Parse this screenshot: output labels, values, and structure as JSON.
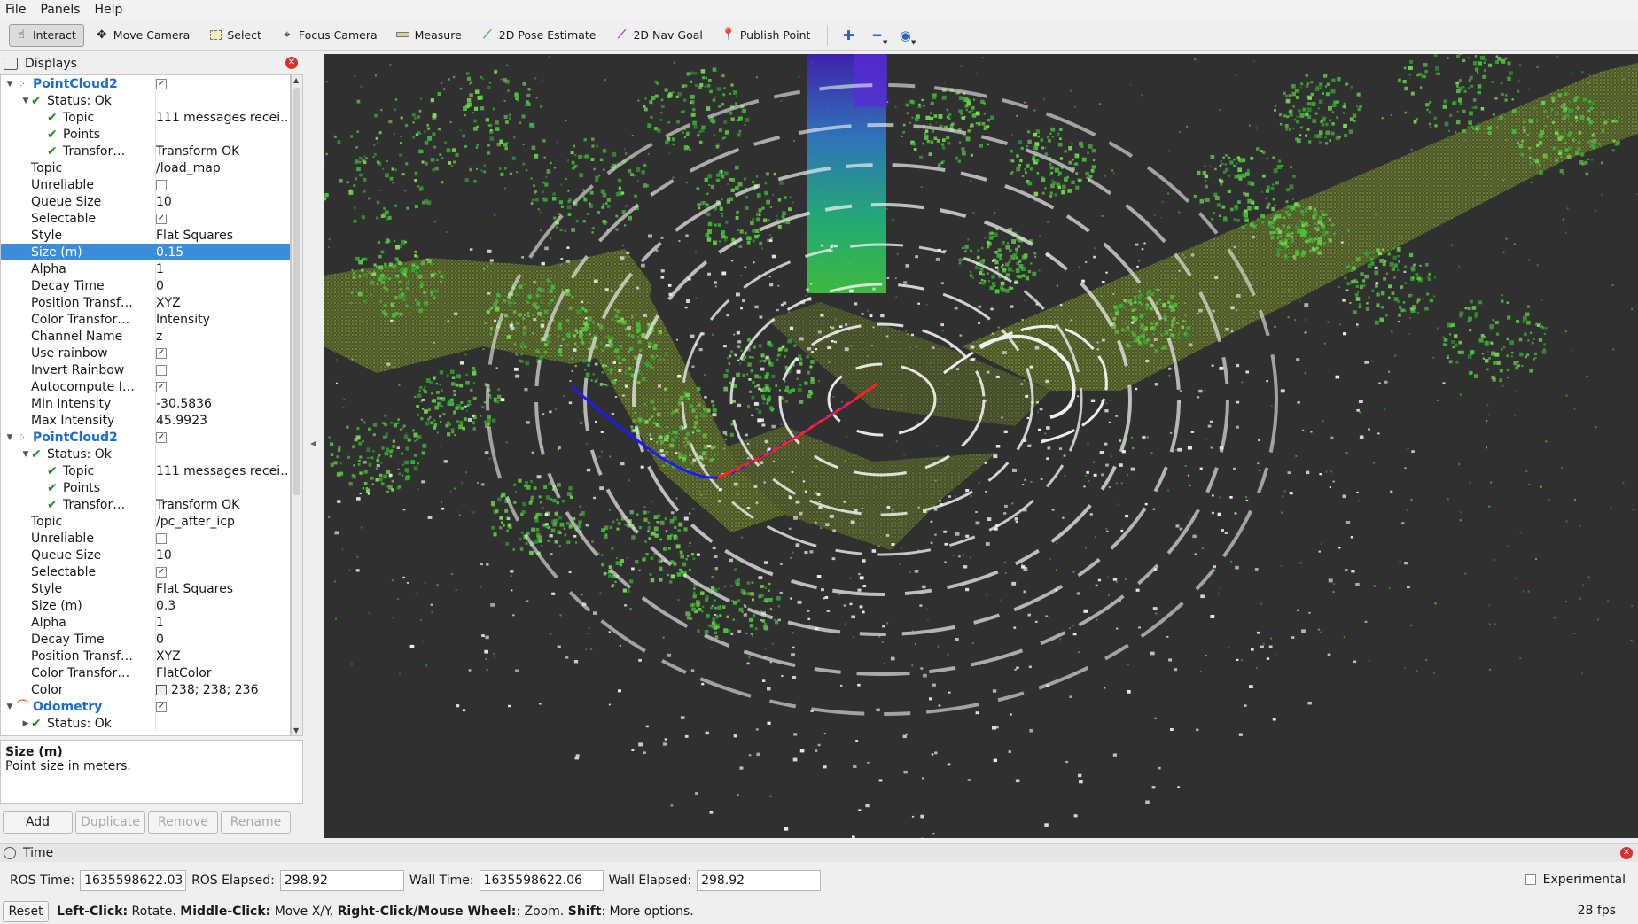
{
  "menu": [
    "File",
    "Panels",
    "Help"
  ],
  "toolbar": {
    "tools": [
      {
        "label": "Interact",
        "icon": "hand-icon",
        "active": true
      },
      {
        "label": "Move Camera",
        "icon": "move-camera-icon",
        "active": false
      },
      {
        "label": "Select",
        "icon": "select-icon",
        "active": false
      },
      {
        "label": "Focus Camera",
        "icon": "focus-camera-icon",
        "active": false
      },
      {
        "label": "Measure",
        "icon": "measure-icon",
        "active": false
      },
      {
        "label": "2D Pose Estimate",
        "icon": "pose-estimate-icon",
        "active": false
      },
      {
        "label": "2D Nav Goal",
        "icon": "nav-goal-icon",
        "active": false
      },
      {
        "label": "Publish Point",
        "icon": "publish-point-icon",
        "active": false
      }
    ]
  },
  "displays": {
    "title": "Displays",
    "tree": [
      {
        "indent": 0,
        "arrow": "down",
        "icon": "pointcloud",
        "label": "PointCloud2",
        "value_checkbox": true,
        "plugin": true
      },
      {
        "indent": 1,
        "arrow": "down",
        "check": true,
        "label": "Status: Ok",
        "value": ""
      },
      {
        "indent": 2,
        "check": true,
        "label": "Topic",
        "value": "111 messages recei…"
      },
      {
        "indent": 2,
        "check": true,
        "label": "Points",
        "value": ""
      },
      {
        "indent": 2,
        "check": true,
        "label": "Transfor…",
        "value": "Transform OK"
      },
      {
        "indent": 1,
        "label": "Topic",
        "value": "/load_map"
      },
      {
        "indent": 1,
        "label": "Unreliable",
        "value_checkbox": false
      },
      {
        "indent": 1,
        "label": "Queue Size",
        "value": "10"
      },
      {
        "indent": 1,
        "label": "Selectable",
        "value_checkbox": true
      },
      {
        "indent": 1,
        "label": "Style",
        "value": "Flat Squares"
      },
      {
        "indent": 1,
        "label": "Size (m)",
        "value": "0.15",
        "selected": true
      },
      {
        "indent": 1,
        "label": "Alpha",
        "value": "1"
      },
      {
        "indent": 1,
        "label": "Decay Time",
        "value": "0"
      },
      {
        "indent": 1,
        "label": "Position Transf…",
        "value": "XYZ"
      },
      {
        "indent": 1,
        "label": "Color Transfor…",
        "value": "Intensity"
      },
      {
        "indent": 1,
        "label": "Channel Name",
        "value": "z"
      },
      {
        "indent": 1,
        "label": "Use rainbow",
        "value_checkbox": true
      },
      {
        "indent": 1,
        "label": "Invert Rainbow",
        "value_checkbox": false
      },
      {
        "indent": 1,
        "label": "Autocompute I…",
        "value_checkbox": true
      },
      {
        "indent": 1,
        "label": "Min Intensity",
        "value": "-30.5836"
      },
      {
        "indent": 1,
        "label": "Max Intensity",
        "value": "45.9923"
      },
      {
        "indent": 0,
        "arrow": "down",
        "icon": "pointcloud",
        "label": "PointCloud2",
        "value_checkbox": true,
        "plugin": true
      },
      {
        "indent": 1,
        "arrow": "down",
        "check": true,
        "label": "Status: Ok",
        "value": ""
      },
      {
        "indent": 2,
        "check": true,
        "label": "Topic",
        "value": "111 messages recei…"
      },
      {
        "indent": 2,
        "check": true,
        "label": "Points",
        "value": ""
      },
      {
        "indent": 2,
        "check": true,
        "label": "Transfor…",
        "value": "Transform OK"
      },
      {
        "indent": 1,
        "label": "Topic",
        "value": "/pc_after_icp"
      },
      {
        "indent": 1,
        "label": "Unreliable",
        "value_checkbox": false
      },
      {
        "indent": 1,
        "label": "Queue Size",
        "value": "10"
      },
      {
        "indent": 1,
        "label": "Selectable",
        "value_checkbox": true
      },
      {
        "indent": 1,
        "label": "Style",
        "value": "Flat Squares"
      },
      {
        "indent": 1,
        "label": "Size (m)",
        "value": "0.3"
      },
      {
        "indent": 1,
        "label": "Alpha",
        "value": "1"
      },
      {
        "indent": 1,
        "label": "Decay Time",
        "value": "0"
      },
      {
        "indent": 1,
        "label": "Position Transf…",
        "value": "XYZ"
      },
      {
        "indent": 1,
        "label": "Color Transfor…",
        "value": "FlatColor"
      },
      {
        "indent": 1,
        "label": "Color",
        "value": "238; 238; 236",
        "swatch": "#eeeeec"
      },
      {
        "indent": 0,
        "arrow": "down",
        "icon": "odometry",
        "label": "Odometry",
        "value_checkbox": true,
        "plugin": true
      },
      {
        "indent": 1,
        "arrow": "right",
        "check": true,
        "label": "Status: Ok",
        "value": ""
      }
    ],
    "description": {
      "heading": "Size (m)",
      "body": "Point size in meters."
    },
    "buttons": [
      {
        "label": "Add",
        "enabled": true
      },
      {
        "label": "Duplicate",
        "enabled": false
      },
      {
        "label": "Remove",
        "enabled": false
      },
      {
        "label": "Rename",
        "enabled": false
      }
    ]
  },
  "time": {
    "title": "Time",
    "ros_time_label": "ROS Time:",
    "ros_time": "1635598622.03",
    "ros_elapsed_label": "ROS Elapsed:",
    "ros_elapsed": "298.92",
    "wall_time_label": "Wall Time:",
    "wall_time": "1635598622.06",
    "wall_elapsed_label": "Wall Elapsed:",
    "wall_elapsed": "298.92",
    "experimental_label": "Experimental"
  },
  "status": {
    "reset": "Reset",
    "hint": [
      {
        "b": "Left-Click:",
        "t": " Rotate. "
      },
      {
        "b": "Middle-Click:",
        "t": " Move X/Y. "
      },
      {
        "b": "Right-Click/Mouse Wheel:",
        "t": ": Zoom. "
      },
      {
        "b": "Shift",
        "t": ": More options."
      }
    ],
    "fps": "28 fps"
  },
  "colors": {
    "background_3d": "#303030",
    "selection": "#3b8ddb",
    "plugin_label": "#1a6dd0",
    "path_blue": "#1a1aff",
    "path_red": "#ff2020"
  }
}
